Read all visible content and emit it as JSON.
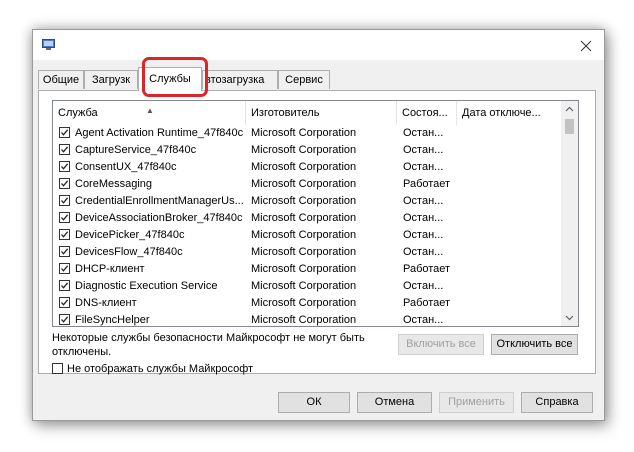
{
  "tabs": [
    "Общие",
    "Загрузк",
    "Службы",
    "втозагрузка",
    "Сервис"
  ],
  "list": {
    "headers": [
      "Служба",
      "Изготовитель",
      "Состоя...",
      "Дата отключе..."
    ],
    "rows": [
      {
        "name": "Agent Activation Runtime_47f840c",
        "vendor": "Microsoft Corporation",
        "state": "Остан...",
        "date": "",
        "checked": true
      },
      {
        "name": "CaptureService_47f840c",
        "vendor": "Microsoft Corporation",
        "state": "Остан...",
        "date": "",
        "checked": true
      },
      {
        "name": "ConsentUX_47f840c",
        "vendor": "Microsoft Corporation",
        "state": "Остан...",
        "date": "",
        "checked": true
      },
      {
        "name": "CoreMessaging",
        "vendor": "Microsoft Corporation",
        "state": "Работает",
        "date": "",
        "checked": true
      },
      {
        "name": "CredentialEnrollmentManagerUs...",
        "vendor": "Microsoft Corporation",
        "state": "Остан...",
        "date": "",
        "checked": true
      },
      {
        "name": "DeviceAssociationBroker_47f840c",
        "vendor": "Microsoft Corporation",
        "state": "Остан...",
        "date": "",
        "checked": true
      },
      {
        "name": "DevicePicker_47f840c",
        "vendor": "Microsoft Corporation",
        "state": "Остан...",
        "date": "",
        "checked": true
      },
      {
        "name": "DevicesFlow_47f840c",
        "vendor": "Microsoft Corporation",
        "state": "Остан...",
        "date": "",
        "checked": true
      },
      {
        "name": "DHCP-клиент",
        "vendor": "Microsoft Corporation",
        "state": "Работает",
        "date": "",
        "checked": true
      },
      {
        "name": "Diagnostic Execution Service",
        "vendor": "Microsoft Corporation",
        "state": "Остан...",
        "date": "",
        "checked": true
      },
      {
        "name": "DNS-клиент",
        "vendor": "Microsoft Corporation",
        "state": "Работает",
        "date": "",
        "checked": true
      },
      {
        "name": "FileSyncHelper",
        "vendor": "Microsoft Corporation",
        "state": "Остан...",
        "date": "",
        "checked": true
      }
    ]
  },
  "note": "Некоторые службы безопасности Майкрософт не могут быть отключены.",
  "enable_all_label": "Включить все",
  "disable_all_label": "Отключить все",
  "hide_ms_label": "Не отображать службы Майкрософт",
  "hide_ms_checked": false,
  "footer": {
    "ok_label": "ОК",
    "cancel_label": "Отмена",
    "apply_label": "Применить",
    "help_label": "Справка"
  },
  "icons": {
    "app": "msconfig-app-icon",
    "close": "close-icon",
    "sort": "sort-up-arrow-icon",
    "scroll_up": "chevron-up-icon",
    "scroll_down": "chevron-down-icon",
    "check": "checkmark-icon"
  },
  "colors": {
    "highlight": "#d9262a",
    "window_bg": "#f0f0f0",
    "panel_bg": "#ffffff"
  }
}
